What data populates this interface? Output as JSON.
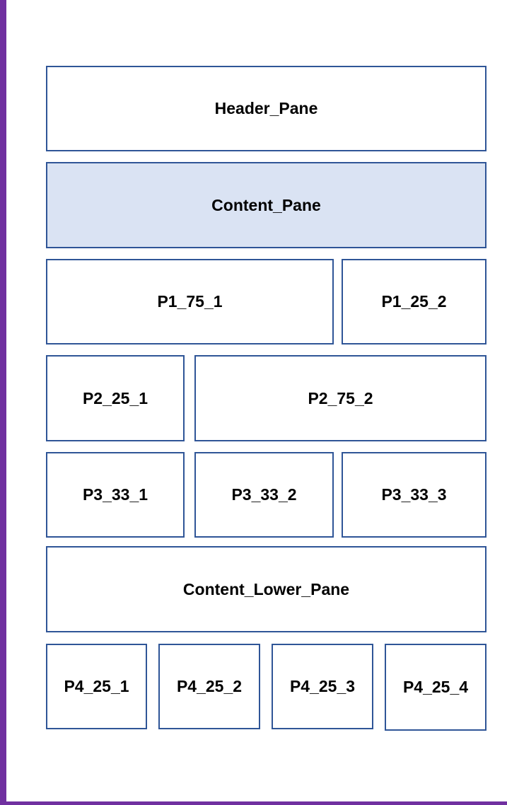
{
  "colors": {
    "frame_border": "#7030a0",
    "pane_border": "#2f5597",
    "highlight_fill": "#dae3f3"
  },
  "panes": {
    "header": "Header_Pane",
    "content": "Content_Pane",
    "p1_75_1": "P1_75_1",
    "p1_25_2": "P1_25_2",
    "p2_25_1": "P2_25_1",
    "p2_75_2": "P2_75_2",
    "p3_33_1": "P3_33_1",
    "p3_33_2": "P3_33_2",
    "p3_33_3": "P3_33_3",
    "content_lower": "Content_Lower_Pane",
    "p4_25_1": "P4_25_1",
    "p4_25_2": "P4_25_2",
    "p4_25_3": "P4_25_3",
    "p4_25_4": "P4_25_4"
  }
}
